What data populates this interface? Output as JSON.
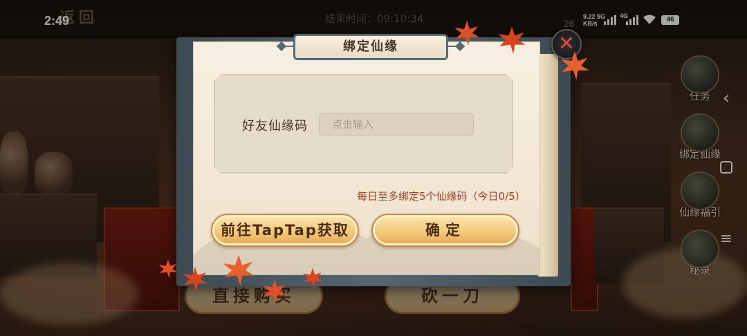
{
  "status_bar": {
    "time": "2:49",
    "net_speed_value": "9.22",
    "net_speed_unit": "KB/s",
    "net_5g": "5G",
    "net_4g": "4G",
    "battery": "46"
  },
  "scene": {
    "back_label": "返回",
    "end_time": "结束时间：09:10:34",
    "corner_badge": "26",
    "side_menu": [
      "任务",
      "绑定仙缘",
      "仙缘福引",
      "秘录"
    ],
    "bottom_buttons": [
      "直接购买",
      "砍一刀"
    ]
  },
  "dialog": {
    "title": "绑定仙缘",
    "close_symbol": "✕",
    "field_label": "好友仙缘码",
    "input_placeholder": "点击输入",
    "input_value": "",
    "limit_text": "每日至多绑定5个仙缘码（今日0/5）",
    "taptap_button": "前往TapTap获取",
    "confirm_button": "确定"
  },
  "colors": {
    "accent_gold": "#f3c97a",
    "close_red": "#e64a3b",
    "frame_slate": "#556a74",
    "limit_text_red": "#a0401f"
  },
  "icons": [
    "back-chevron-icon",
    "home-square-icon",
    "menu-lines-icon",
    "wifi-icon",
    "signal-icon",
    "maple-leaf-icon",
    "close-icon"
  ]
}
